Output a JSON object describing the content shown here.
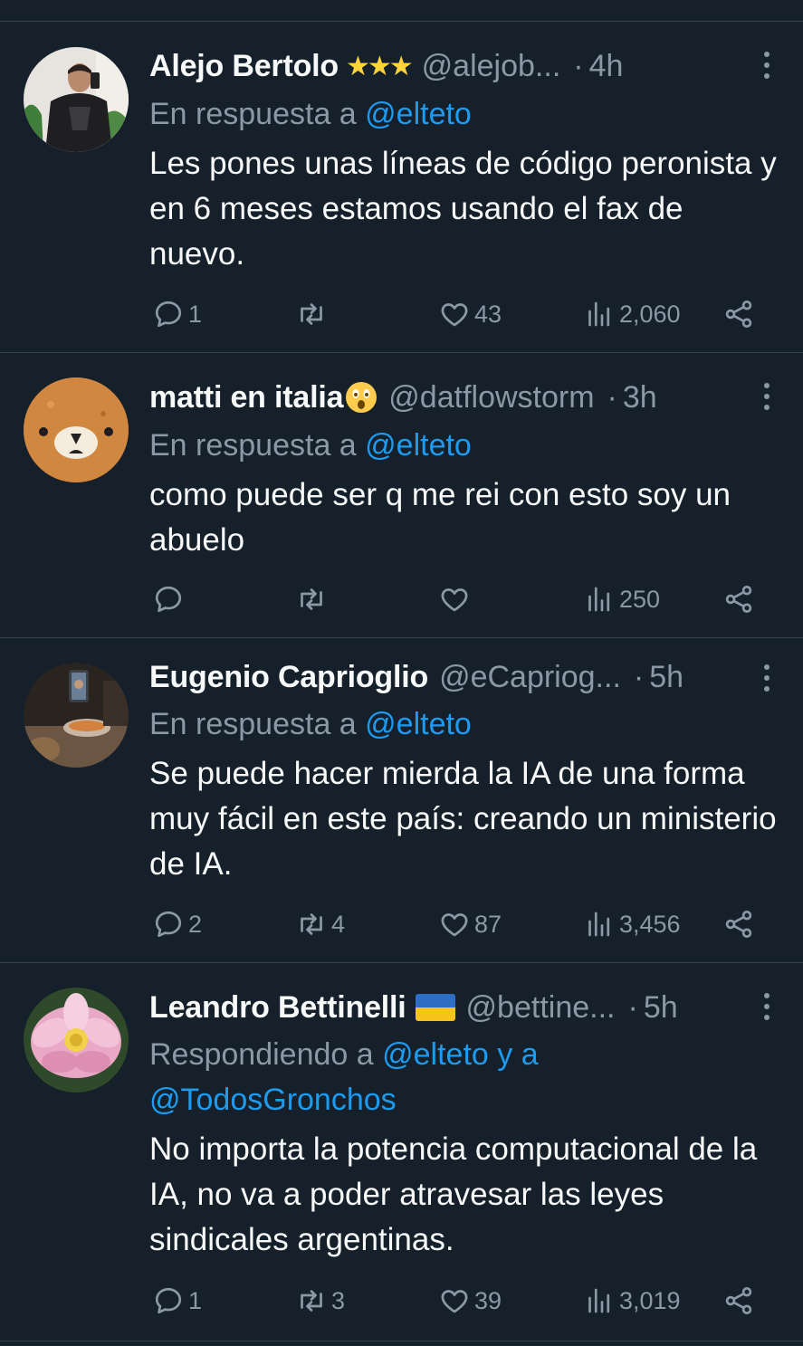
{
  "tweets": [
    {
      "name": "Alejo Bertolo",
      "badge": "★★★",
      "handle": "@alejob...",
      "dot": "·",
      "time": "4h",
      "reply_prefix": "En respuesta a",
      "reply_mention": "@elteto",
      "body": "Les pones unas líneas de código peronista y en 6 meses estamos usando el fax de nuevo.",
      "replies": "1",
      "retweets": "",
      "likes": "43",
      "views": "2,060"
    },
    {
      "name": "matti en italia",
      "handle": "@datflowstorm",
      "dot": "·",
      "time": "3h",
      "reply_prefix": "En respuesta a",
      "reply_mention": "@elteto",
      "body": "como puede ser q me rei con esto soy un abuelo",
      "replies": "",
      "retweets": "",
      "likes": "",
      "views": "250"
    },
    {
      "name": "Eugenio Caprioglio",
      "handle": "@eCapriog...",
      "dot": "·",
      "time": "5h",
      "reply_prefix": "En respuesta a",
      "reply_mention": "@elteto",
      "body": "Se puede hacer mierda la IA de una forma muy fácil en este país: creando un ministerio de IA.",
      "replies": "2",
      "retweets": "4",
      "likes": "87",
      "views": "3,456"
    },
    {
      "name": "Leandro Bettinelli",
      "handle": "@bettine...",
      "dot": "·",
      "time": "5h",
      "reply_prefix": "Respondiendo a",
      "reply_mention": "@elteto y a",
      "reply_mention_2": "@TodosGronchos",
      "body": "No importa la potencia computacional de la IA, no va a poder atravesar las leyes sindicales argentinas.",
      "replies": "1",
      "retweets": "3",
      "likes": "39",
      "views": "3,019"
    }
  ],
  "icons": {
    "reply": "reply-icon",
    "retweet": "retweet-icon",
    "like": "heart-icon",
    "views": "views-icon",
    "share": "share-icon",
    "more": "more-icon"
  },
  "colors": {
    "background": "#15202b",
    "text": "#f7f9f9",
    "secondary": "#8b98a5",
    "accent": "#1d9bf0",
    "divider": "#38444d"
  }
}
